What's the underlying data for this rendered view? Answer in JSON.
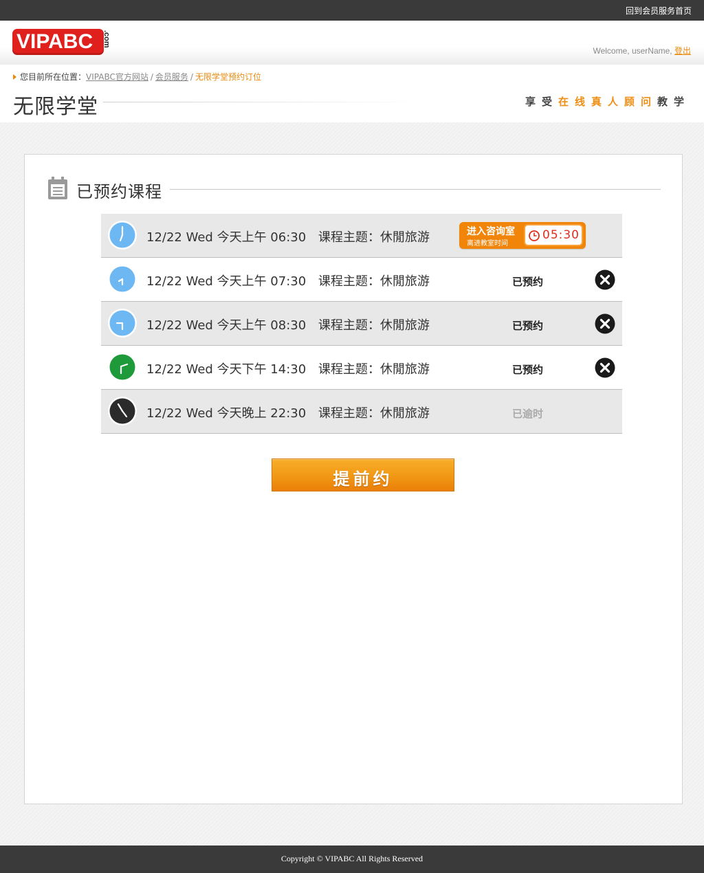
{
  "topbar": {
    "home_link": "回到会员服务首页"
  },
  "header": {
    "logo_text": "VIPABC",
    "logo_suffix": ".com",
    "welcome": "Welcome, userName,",
    "logout": "登出"
  },
  "breadcrumb": {
    "prefix": "您目前所在位置：",
    "items": [
      "VIPABC官方网站",
      "会员服务"
    ],
    "separator": "/",
    "current": "无限学堂预约订位"
  },
  "page": {
    "title": "无限学堂",
    "slogan": {
      "part1": "享受",
      "part2": "在线真人顾问",
      "part3": "教学"
    }
  },
  "panel": {
    "title": "已预约课程"
  },
  "colors": {
    "accent": "#f0850a",
    "brand_red": "#e0201c",
    "clock_morning": "#6db8f2",
    "clock_afternoon": "#1e9a3a",
    "clock_night": "#2b2b2b"
  },
  "sessions": [
    {
      "date": "12/22 Wed",
      "time": "今天上午 06:30",
      "topic_label": "课程主题：",
      "topic": "休閒旅游",
      "clock": "clock-morning-icon"
    },
    {
      "date": "12/22 Wed",
      "time": "今天上午 07:30",
      "topic_label": "课程主题：",
      "topic": "休閒旅游",
      "status": "已预约",
      "clock": "clock-morning-icon"
    },
    {
      "date": "12/22 Wed",
      "time": "今天上午 08:30",
      "topic_label": "课程主题：",
      "topic": "休閒旅游",
      "status": "已预约",
      "clock": "clock-morning-icon"
    },
    {
      "date": "12/22 Wed",
      "time": "今天下午 14:30",
      "topic_label": "课程主题：",
      "topic": "休閒旅游",
      "status": "已预约",
      "clock": "clock-afternoon-icon"
    },
    {
      "date": "12/22 Wed",
      "time": "今天晚上 22:30",
      "topic_label": "课程主题：",
      "topic": "休閒旅游",
      "status": "已逾时",
      "clock": "clock-night-icon"
    }
  ],
  "enter_room": {
    "label": "进入咨询室",
    "sub_label": "离进教室时间",
    "countdown": "05:30"
  },
  "book_button": "提前约",
  "footer": {
    "copyright": "Copyright © VIPABC All Rights Reserved"
  }
}
